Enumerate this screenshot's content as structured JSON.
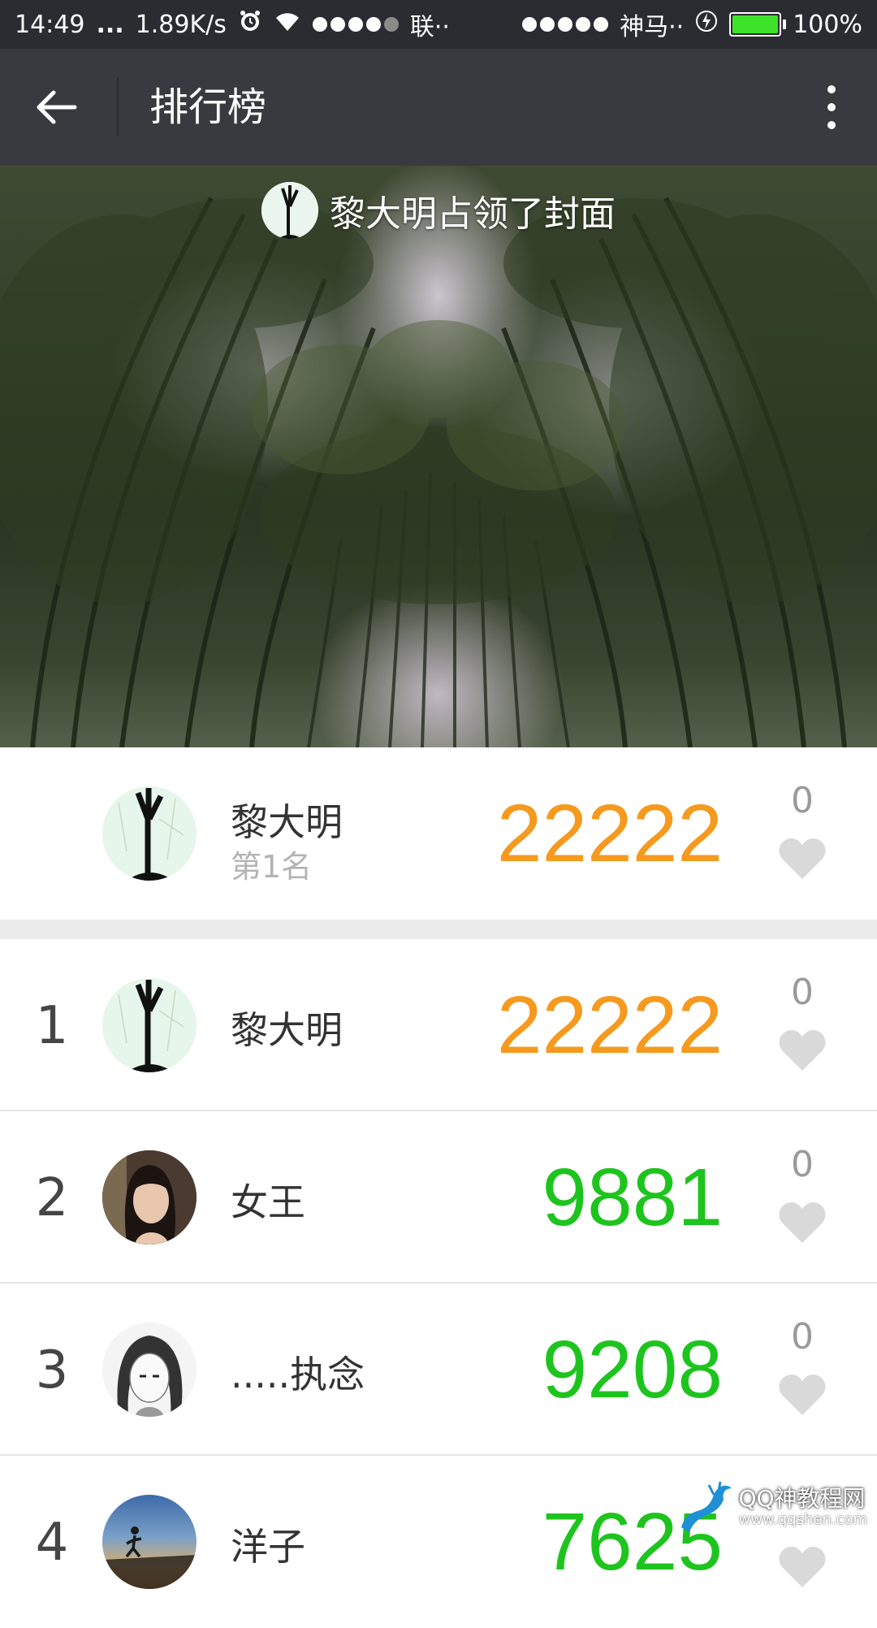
{
  "status_bar": {
    "time": "14:49",
    "dots": "...",
    "speed": "1.89K/s",
    "carrier1": "联··",
    "carrier2": "神马··",
    "battery": "100%"
  },
  "header": {
    "title": "排行榜"
  },
  "cover": {
    "text": "黎大明占领了封面"
  },
  "my_rank": {
    "name": "黎大明",
    "rank_label": "第1名",
    "steps": "22222",
    "likes": "0"
  },
  "rank_list": [
    {
      "rank": "1",
      "name": "黎大明",
      "steps": "22222",
      "likes": "0",
      "color": "#f59a1e"
    },
    {
      "rank": "2",
      "name": "女王",
      "steps": "9881",
      "likes": "0",
      "color": "#1ec41e"
    },
    {
      "rank": "3",
      "name": ".....执念",
      "steps": "9208",
      "likes": "0",
      "color": "#1ec41e"
    },
    {
      "rank": "4",
      "name": "洋子",
      "steps": "7625",
      "likes": "",
      "color": "#1ec41e"
    }
  ],
  "watermark": {
    "text": "QQ神教程网",
    "url": "www.qqshen.com"
  },
  "colors": {
    "status_bg": "#2b2c31",
    "header_bg": "#393a3f",
    "orange": "#f59a1e",
    "green": "#1ec41e",
    "heart": "#d9d9d9"
  },
  "icons": {
    "back": "arrow-left-icon",
    "more": "more-vertical-icon",
    "like": "heart-icon",
    "alarm": "alarm-icon",
    "wifi": "wifi-icon",
    "charging": "charging-icon"
  }
}
